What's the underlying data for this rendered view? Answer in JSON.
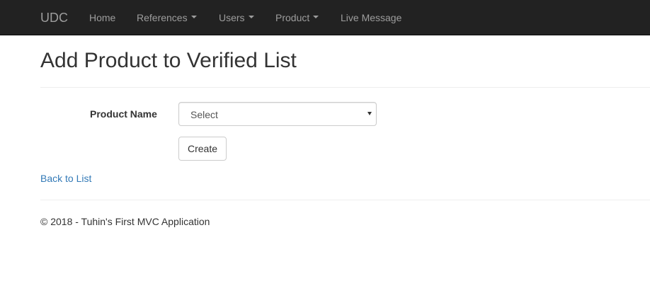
{
  "navbar": {
    "brand": "UDC",
    "items": [
      {
        "label": "Home",
        "dropdown": false
      },
      {
        "label": "References",
        "dropdown": true
      },
      {
        "label": "Users",
        "dropdown": true
      },
      {
        "label": "Product",
        "dropdown": true
      },
      {
        "label": "Live Message",
        "dropdown": false
      }
    ]
  },
  "page": {
    "title": "Add Product to Verified List"
  },
  "form": {
    "product_name_label": "Product Name",
    "product_select_value": "Select",
    "create_label": "Create"
  },
  "links": {
    "back_to_list": "Back to List"
  },
  "footer": {
    "text": "© 2018 - Tuhin's First MVC Application"
  },
  "colors": {
    "navbar_bg": "#222222",
    "nav_text": "#9d9d9d",
    "link": "#337ab7",
    "text": "#333333"
  }
}
